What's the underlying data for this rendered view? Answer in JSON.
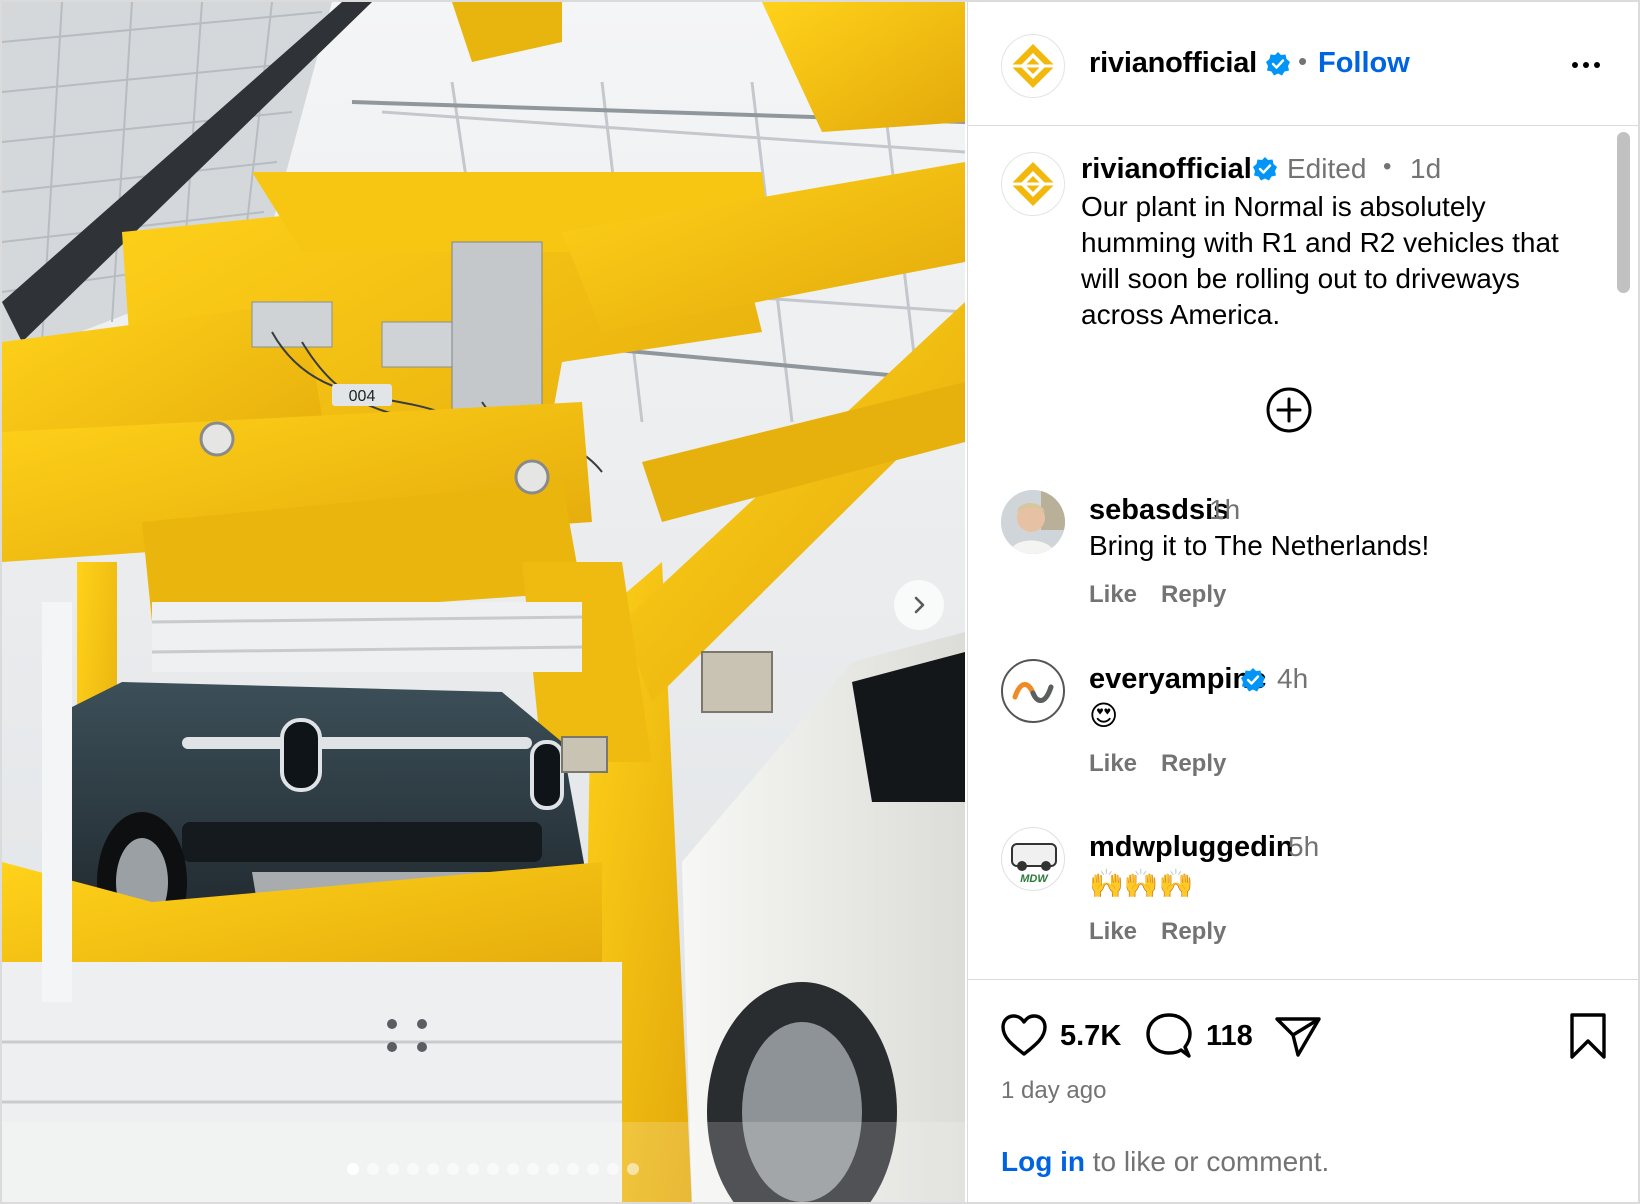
{
  "post": {
    "username": "rivianofficial",
    "follow_label": "Follow",
    "separator": "•",
    "carousel_dots": 15,
    "carousel_active": 0,
    "caption": {
      "username": "rivianofficial",
      "edited": "Edited",
      "dot": "•",
      "time": "1d",
      "text": "Our plant in Normal is absolutely humming with R1 and R2 vehicles that will soon be rolling out to driveways across America."
    },
    "photo": {
      "plate_label": "004"
    }
  },
  "comments": [
    {
      "username": "sebasdsis",
      "time": "1h",
      "text": "Bring it to The Netherlands!",
      "like": "Like",
      "reply": "Reply",
      "verified": false
    },
    {
      "username": "everyampinc",
      "time": "4h",
      "text": "😍",
      "like": "Like",
      "reply": "Reply",
      "verified": true
    },
    {
      "username": "mdwpluggedin",
      "time": "5h",
      "text": "🙌🙌🙌",
      "like": "Like",
      "reply": "Reply",
      "verified": false,
      "avatar_text": "MDW"
    }
  ],
  "actions": {
    "likes": "5.7K",
    "comments": "118",
    "date": "1 day ago",
    "login_link": "Log in",
    "login_rest": " to like or comment."
  },
  "colors": {
    "brand_yellow": "#f2b90c",
    "verified_blue": "#0095f6",
    "link_blue": "#0064e0",
    "muted": "#737373"
  }
}
